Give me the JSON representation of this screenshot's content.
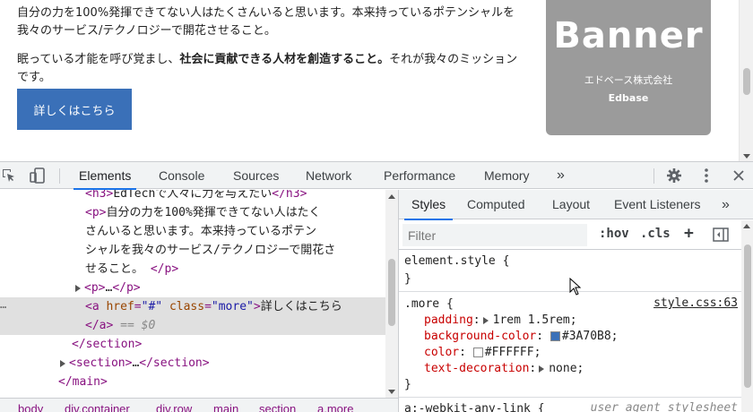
{
  "page": {
    "paragraph1": "自分の力を100%発揮できてない人はたくさんいると思います。本来持っているポテンシャルを我々のサービス/テクノロジーで開花させること。",
    "paragraph2_pre": "眠っている才能を呼び覚まし、",
    "paragraph2_bold": "社会に貢献できる人材を創造すること。",
    "paragraph2_post": "それが我々のミッションです。",
    "more_button": "詳しくはこちら",
    "banner": {
      "title": "Banner",
      "company": "エドベース株式会社",
      "sub": "Edbase",
      "bg": "#9b9b9b"
    }
  },
  "devtools": {
    "tabs": [
      "Elements",
      "Console",
      "Sources",
      "Network",
      "Performance",
      "Memory"
    ],
    "active_tab": "Elements",
    "more_tabs": "»",
    "icons": [
      "inspect-icon",
      "device-toolbar-icon",
      "settings-icon",
      "kebab-menu-icon",
      "close-icon"
    ],
    "elements": {
      "h3_text": "EdTechで人々に力を与えたい",
      "p_text1": "自分の力を100%発揮できてない人はたく",
      "p_text2": "さんいると思います。本来持っているポテン",
      "p_text3": "シャルを我々のサービス/テクノロジーで開花さ",
      "p_text4": "せること。",
      "collapsed_p": "…",
      "a_href": "\"#\"",
      "a_class": "\"more\"",
      "a_text": "詳しくはこちら",
      "eq0": "== $0",
      "section_collapsed": "…",
      "dots": "…"
    },
    "breadcrumb": [
      "body",
      "div.container",
      "div.row",
      "main",
      "section",
      "a.more"
    ],
    "styles_tabs": [
      "Styles",
      "Computed",
      "Layout",
      "Event Listeners"
    ],
    "styles_more": "»",
    "filter_placeholder": "Filter",
    "hov": ":hov",
    "cls": ".cls",
    "add": "+",
    "rules": {
      "element_style": "element.style {",
      "more_selector": ".more {",
      "source": "style.css:63",
      "padding_prop": "padding",
      "padding_val": "1rem 1.5rem;",
      "bg_prop": "background-color",
      "bg_val": "#3A70B8;",
      "color_prop": "color",
      "color_val": "#FFFFFF;",
      "td_prop": "text-decoration",
      "td_val": "none;",
      "close": "}",
      "ua_selector": "a:-webkit-any-link {",
      "ua_source": "user agent stylesheet"
    },
    "colors": {
      "accent": "#1a73e8",
      "swatch_bg": "#3A70B8",
      "swatch_fg": "#FFFFFF"
    }
  }
}
